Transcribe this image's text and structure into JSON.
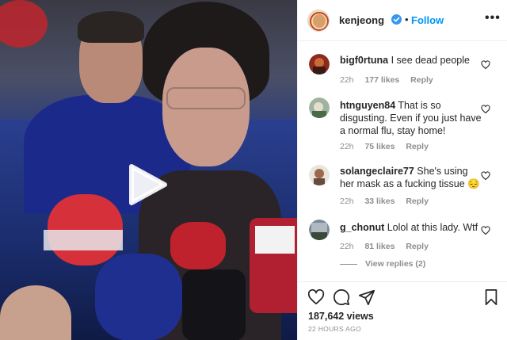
{
  "post": {
    "username": "kenjeong",
    "follow_label": "Follow",
    "separator": "•",
    "more_label": "•••",
    "views": "187,642 views",
    "time_ago": "22 HOURS AGO"
  },
  "comments": [
    {
      "user": "bigf0rtuna",
      "text": "I see dead people",
      "age": "22h",
      "likes": "177 likes",
      "reply": "Reply",
      "avatar_color": "#8c2a1c"
    },
    {
      "user": "htnguyen84",
      "text": "That is so disgusting. Even if you just have a normal flu, stay home!",
      "age": "22h",
      "likes": "75 likes",
      "reply": "Reply",
      "avatar_color": "#6a8a6a"
    },
    {
      "user": "solangeclaire77",
      "text": "She's using her mask as a fucking tissue 😔",
      "age": "22h",
      "likes": "33 likes",
      "reply": "Reply",
      "avatar_color": "#9a7a66"
    },
    {
      "user": "g_chonut",
      "text": "Lolol at this lady. Wtf",
      "age": "22h",
      "likes": "81 likes",
      "reply": "Reply",
      "avatar_color": "#4a5a6a"
    }
  ],
  "view_replies": "View replies (2)",
  "icons": {
    "play": "play-icon",
    "verified": "verified-badge-icon",
    "heart": "heart-outline-icon",
    "comment": "comment-icon",
    "share": "paper-plane-icon",
    "bookmark": "bookmark-icon"
  },
  "colors": {
    "follow_blue": "#0095f6",
    "meta_gray": "#8e8e8e",
    "text": "#262626"
  }
}
